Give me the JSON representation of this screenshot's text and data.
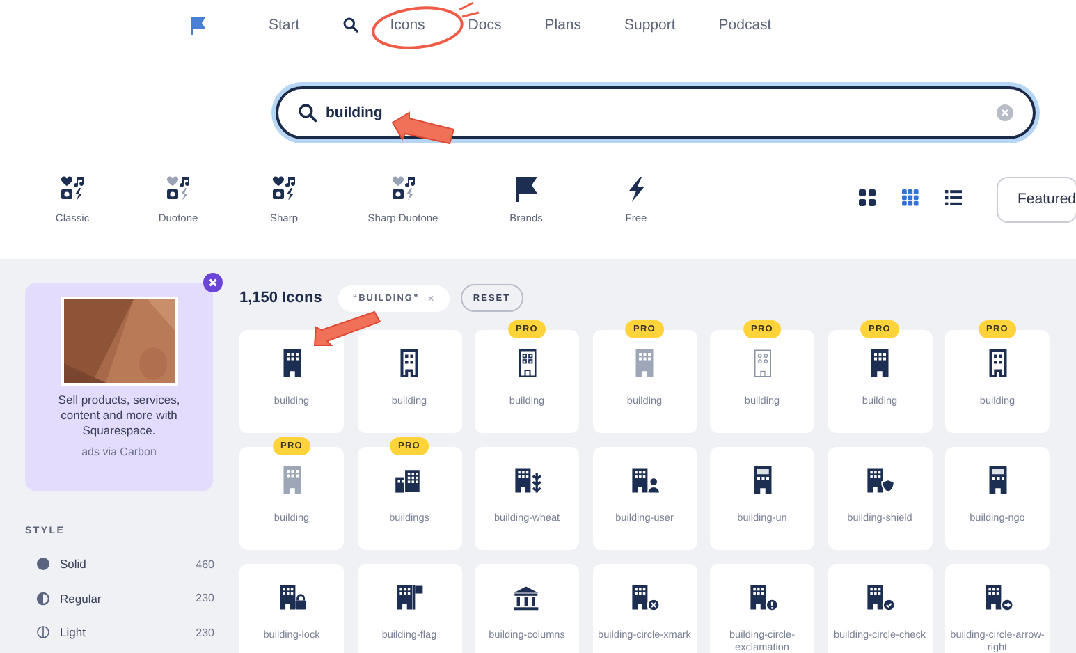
{
  "nav": {
    "items": [
      {
        "kind": "text",
        "label": "Start"
      },
      {
        "kind": "search"
      },
      {
        "kind": "text",
        "label": "Icons"
      },
      {
        "kind": "text",
        "label": "Docs"
      },
      {
        "kind": "text",
        "label": "Plans"
      },
      {
        "kind": "text",
        "label": "Support"
      },
      {
        "kind": "text",
        "label": "Podcast"
      }
    ]
  },
  "search": {
    "value": "building"
  },
  "families": [
    {
      "label": "Classic",
      "kind": "classic"
    },
    {
      "label": "Duotone",
      "kind": "duotone"
    },
    {
      "label": "Sharp",
      "kind": "classic"
    },
    {
      "label": "Sharp Duotone",
      "kind": "duotone"
    },
    {
      "label": "Brands",
      "kind": "flag"
    },
    {
      "label": "Free",
      "kind": "bolt"
    }
  ],
  "views": [
    {
      "kind": "large",
      "selected": false
    },
    {
      "kind": "small",
      "selected": true
    },
    {
      "kind": "list",
      "selected": false
    }
  ],
  "sort": {
    "value": "Featured"
  },
  "ad": {
    "text": "Sell products, services, content and more with Squarespace.",
    "credit": "ads via Carbon"
  },
  "filters": {
    "heading": "STYLE",
    "items": [
      {
        "kind": "solid",
        "label": "Solid",
        "count": "460"
      },
      {
        "kind": "regular",
        "label": "Regular",
        "count": "230"
      },
      {
        "kind": "light",
        "label": "Light",
        "count": "230"
      }
    ]
  },
  "results": {
    "count": "1,150 Icons",
    "tag": "“BUILDING”",
    "tag_close": "×",
    "reset": "RESET"
  },
  "icons": [
    {
      "name": "building",
      "kind": "solid"
    },
    {
      "name": "building",
      "kind": "regular"
    },
    {
      "name": "building",
      "kind": "light",
      "badge": "PRO"
    },
    {
      "name": "building",
      "kind": "duotone",
      "badge": "PRO"
    },
    {
      "name": "building",
      "kind": "thin",
      "badge": "PRO"
    },
    {
      "name": "building",
      "kind": "solid",
      "badge": "PRO"
    },
    {
      "name": "building",
      "kind": "regular",
      "badge": "PRO"
    },
    {
      "name": "building",
      "kind": "duotone",
      "badge": "PRO"
    },
    {
      "name": "buildings",
      "kind": "buildings",
      "badge": "PRO"
    },
    {
      "name": "building-wheat",
      "kind": "wheat"
    },
    {
      "name": "building-user",
      "kind": "user"
    },
    {
      "name": "building-un",
      "kind": "un"
    },
    {
      "name": "building-shield",
      "kind": "shield"
    },
    {
      "name": "building-ngo",
      "kind": "ngo"
    },
    {
      "name": "building-lock",
      "kind": "lock"
    },
    {
      "name": "building-flag",
      "kind": "flag"
    },
    {
      "name": "building-columns",
      "kind": "columns"
    },
    {
      "name": "building-circle-xmark",
      "kind": "xmark"
    },
    {
      "name": "building-circle-exclamation",
      "kind": "exclamation"
    },
    {
      "name": "building-circle-check",
      "kind": "check"
    },
    {
      "name": "building-circle-arrow-right",
      "kind": "arrow"
    }
  ]
}
